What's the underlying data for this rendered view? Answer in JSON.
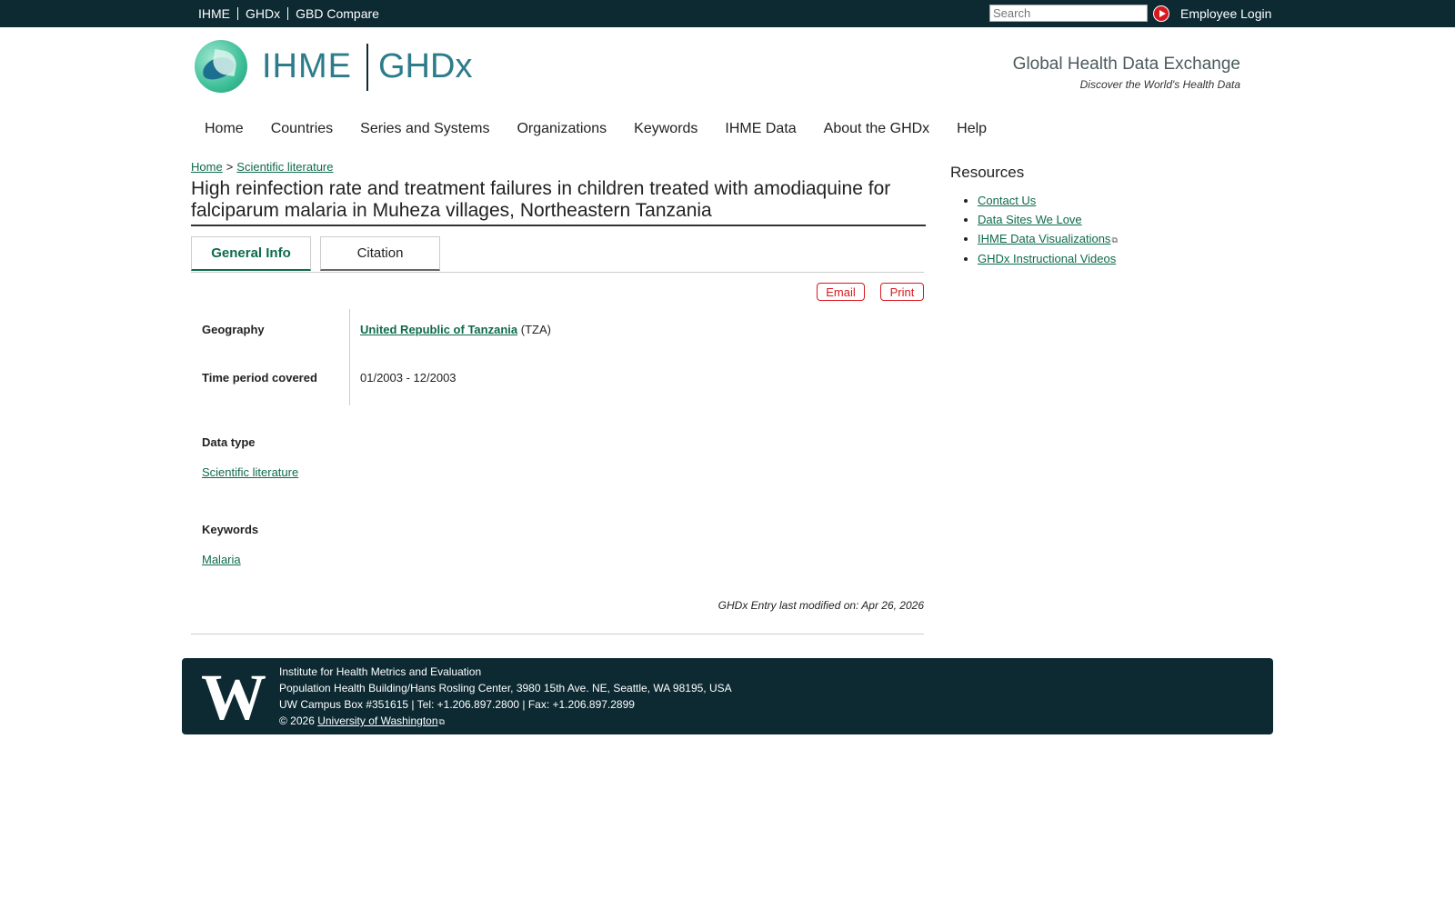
{
  "topbar": {
    "links": [
      "IHME",
      "GHDx",
      "GBD Compare"
    ],
    "search_placeholder": "Search",
    "login": "Employee Login"
  },
  "header": {
    "logo_left": "IHME",
    "logo_right": "GHDx",
    "tagline": "Global Health Data Exchange",
    "subtagline": "Discover the World's Health Data"
  },
  "nav": [
    "Home",
    "Countries",
    "Series and Systems",
    "Organizations",
    "Keywords",
    "IHME Data",
    "About the GHDx",
    "Help"
  ],
  "breadcrumb": {
    "home": "Home",
    "separator": ">",
    "current": "Scientific literature"
  },
  "title": "High reinfection rate and treatment failures in children treated with amodiaquine for falciparum malaria in Muheza villages, Northeastern Tanzania",
  "tabs": [
    "General Info",
    "Citation"
  ],
  "actions": {
    "email": "Email",
    "print": "Print"
  },
  "fields": {
    "geography_label": "Geography",
    "geography_link": "United Republic of Tanzania",
    "geography_code": "(TZA)",
    "time_label": "Time period covered",
    "time_value": "01/2003 - 12/2003",
    "datatype_label": "Data type",
    "datatype_value": "Scientific literature",
    "keywords_label": "Keywords",
    "keywords_value": "Malaria"
  },
  "modified": "GHDx Entry last modified on: Apr 26, 2026",
  "resources": {
    "title": "Resources",
    "items": [
      "Contact Us",
      "Data Sites We Love",
      "IHME Data Visualizations",
      "GHDx Instructional Videos"
    ]
  },
  "footer": {
    "logo": "W",
    "line1": "Institute for Health Metrics and Evaluation",
    "line2": "Population Health Building/Hans Rosling Center, 3980 15th Ave. NE, Seattle, WA 98195, USA",
    "line3": "UW Campus Box #351615 | Tel: +1.206.897.2800 | Fax: +1.206.897.2899",
    "copyright": "© 2026",
    "uw_link": "University of Washington"
  },
  "colors": {
    "topbar": "#0d2a33",
    "link": "#0e6b4a",
    "accent_red": "#d7191f"
  }
}
